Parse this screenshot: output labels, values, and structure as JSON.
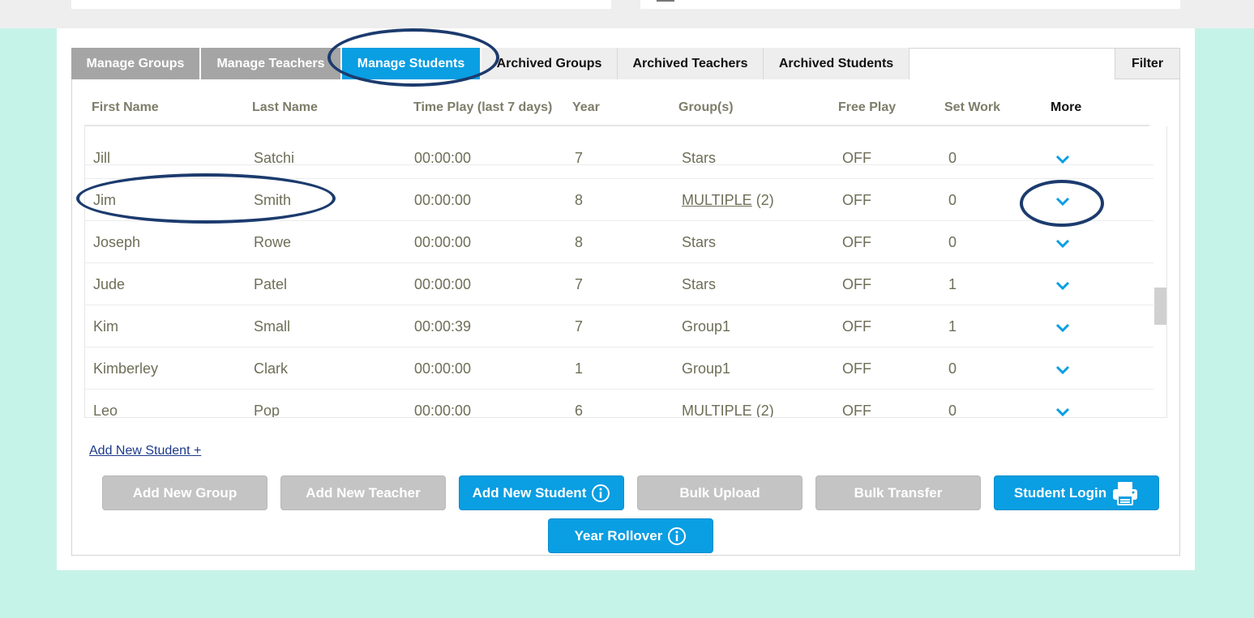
{
  "tabs": [
    {
      "label": "Manage Groups",
      "style": "dark"
    },
    {
      "label": "Manage Teachers",
      "style": "dark"
    },
    {
      "label": "Manage Students",
      "style": "active"
    },
    {
      "label": "Archived Groups",
      "style": "light"
    },
    {
      "label": "Archived Teachers",
      "style": "light"
    },
    {
      "label": "Archived Students",
      "style": "light"
    }
  ],
  "filter_label": "Filter",
  "table": {
    "columns": [
      "First Name",
      "Last Name",
      "Time Play (last 7 days)",
      "Year",
      "Group(s)",
      "Free Play",
      "Set Work",
      "More"
    ],
    "rows": [
      {
        "first": "Jill",
        "last": "Satchi",
        "time": "00:00:00",
        "year": "7",
        "group": "Stars",
        "group_count": "",
        "free_play": "OFF",
        "set_work": "0"
      },
      {
        "first": "Jim",
        "last": "Smith",
        "time": "00:00:00",
        "year": "8",
        "group": "MULTIPLE",
        "group_count": "(2)",
        "free_play": "OFF",
        "set_work": "0"
      },
      {
        "first": "Joseph",
        "last": "Rowe",
        "time": "00:00:00",
        "year": "8",
        "group": "Stars",
        "group_count": "",
        "free_play": "OFF",
        "set_work": "0"
      },
      {
        "first": "Jude",
        "last": "Patel",
        "time": "00:00:00",
        "year": "7",
        "group": "Stars",
        "group_count": "",
        "free_play": "OFF",
        "set_work": "1"
      },
      {
        "first": "Kim",
        "last": "Small",
        "time": "00:00:39",
        "year": "7",
        "group": "Group1",
        "group_count": "",
        "free_play": "OFF",
        "set_work": "1"
      },
      {
        "first": "Kimberley",
        "last": "Clark",
        "time": "00:00:00",
        "year": "1",
        "group": "Group1",
        "group_count": "",
        "free_play": "OFF",
        "set_work": "0"
      },
      {
        "first": "Leo",
        "last": "Pop",
        "time": "00:00:00",
        "year": "6",
        "group": "MULTIPLE",
        "group_count": "(2)",
        "free_play": "OFF",
        "set_work": "0"
      }
    ]
  },
  "add_student_link": "Add New Student +",
  "buttons": {
    "add_group": "Add New Group",
    "add_teacher": "Add New Teacher",
    "add_student": "Add New Student",
    "bulk_upload": "Bulk Upload",
    "bulk_transfer": "Bulk Transfer",
    "student_login": "Student Login",
    "year_rollover": "Year Rollover"
  },
  "colors": {
    "accent": "#0a9ee2",
    "tab_inactive": "#a5a5a5",
    "button_disabled": "#c4c4c4",
    "annotation": "#1c3b6e",
    "background": "#c6f3e8",
    "cell_text": "#6e6e58"
  },
  "icons": {
    "row_expand": "chevron-down-icon",
    "info": "info-icon",
    "printer": "printer-icon"
  }
}
